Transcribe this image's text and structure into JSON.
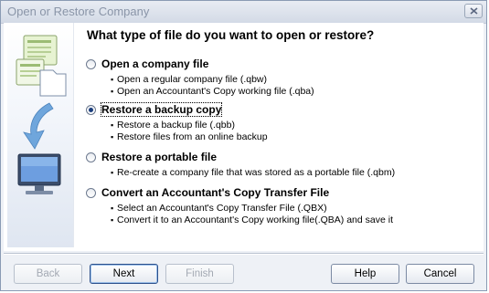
{
  "window": {
    "title": "Open or Restore Company"
  },
  "heading": "What type of file do you want to open or restore?",
  "options": [
    {
      "label": "Open a company file",
      "selected": false,
      "bullets": [
        "Open a regular company file (.qbw)",
        "Open an Accountant's Copy working file (.qba)"
      ]
    },
    {
      "label": "Restore a backup copy",
      "selected": true,
      "bullets": [
        "Restore a backup file (.qbb)",
        "Restore files from an online backup"
      ]
    },
    {
      "label": "Restore a portable file",
      "selected": false,
      "bullets": [
        "Re-create a company file that was stored as a portable file (.qbm)"
      ]
    },
    {
      "label": "Convert an Accountant's Copy Transfer File",
      "selected": false,
      "bullets": [
        "Select an Accountant's Copy Transfer File (.QBX)",
        "Convert it to an Accountant's Copy working file(.QBA) and save it"
      ]
    }
  ],
  "buttons": {
    "back": "Back",
    "next": "Next",
    "finish": "Finish",
    "help": "Help",
    "cancel": "Cancel"
  },
  "colors": {
    "title_text": "#8a95a8",
    "radio_dot": "#1a3d7c",
    "panel_gradient_bottom": "#dfe6f1"
  },
  "icons": [
    "close-icon",
    "file-documents-icon",
    "down-arrow-icon",
    "computer-monitor-icon"
  ]
}
